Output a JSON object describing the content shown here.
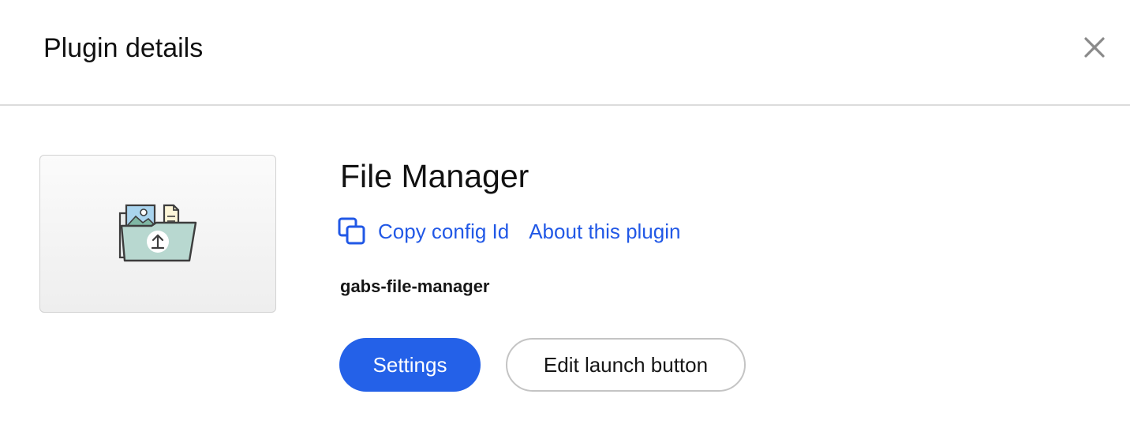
{
  "header": {
    "title": "Plugin details",
    "close_icon": "close-icon"
  },
  "plugin": {
    "name": "File Manager",
    "thumbnail_icon": "folder-upload-icon",
    "config_id": "gabs-file-manager"
  },
  "links": {
    "copy_config_id": "Copy config Id",
    "copy_icon": "copy-icon",
    "about": "About this plugin"
  },
  "actions": {
    "settings": "Settings",
    "edit_launch_button": "Edit launch button"
  },
  "colors": {
    "accent": "#2461e8",
    "link": "#2158e6",
    "divider": "#dcdcdc",
    "folder": "#b8d8d0"
  }
}
